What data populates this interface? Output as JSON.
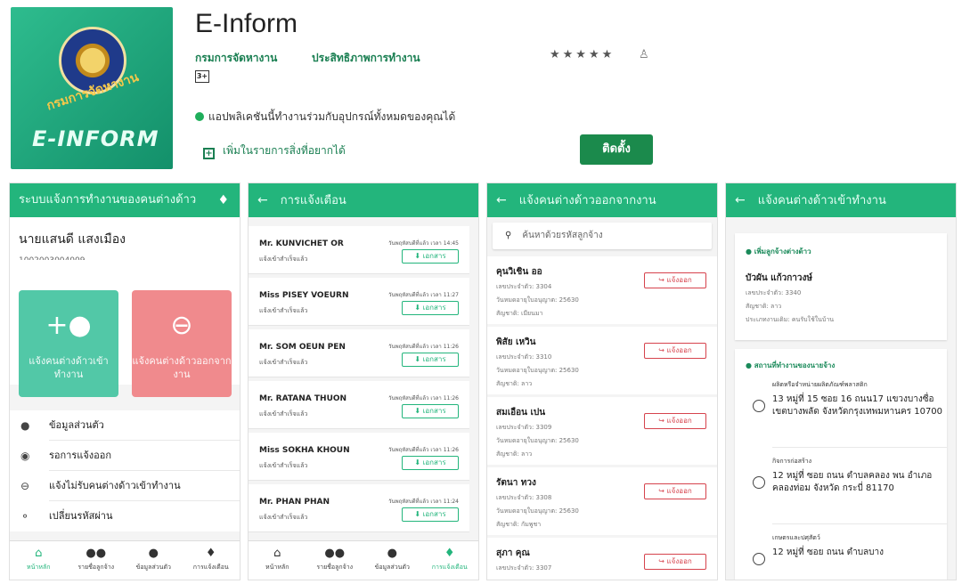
{
  "store": {
    "logo_text": "E-INFORM",
    "logo_arc": "กรมการจัดหางาน",
    "title": "E-Inform",
    "developer": "กรมการจัดหางาน",
    "category": "ประสิทธิภาพการทำงาน",
    "stars": "★★★★★",
    "rating_badge": "3+",
    "compat_text": "แอปพลิเคชันนี้ทำงานร่วมกับอุปกรณ์ทั้งหมดของคุณได้",
    "wishlist_label": "เพิ่มในรายการสิ่งที่อยากได้",
    "install_label": "ติดตั้ง"
  },
  "screen1": {
    "header": "ระบบแจ้งการทำงานของคนต่างด้าว",
    "user_name": "นายแสนดี แสงเมือง",
    "user_id": "1002003004009",
    "tile_in": "แจ้งคนต่างด้าวเข้าทำงาน",
    "tile_out": "แจ้งคนต่างด้าวออกจากงาน",
    "menu": [
      {
        "label": "ข้อมูลส่วนตัว"
      },
      {
        "label": "รอการแจ้งออก"
      },
      {
        "label": "แจ้งไม่รับคนต่างด้าวเข้าทำงาน"
      },
      {
        "label": "เปลี่ยนรหัสผ่าน"
      }
    ]
  },
  "bottom_nav": [
    {
      "label": "หน้าหลัก"
    },
    {
      "label": "รายชื่อลูกจ้าง"
    },
    {
      "label": "ข้อมูลส่วนตัว"
    },
    {
      "label": "การแจ้งเตือน"
    }
  ],
  "screen2": {
    "header": "การแจ้งเตือน",
    "doc_label": "เอกสาร",
    "notifications": [
      {
        "name": "Mr. KUNVICHET OR",
        "status": "แจ้งเข้าสำเร็จแล้ว",
        "time": "วันพฤหัสบดีที่แล้ว เวลา 14:45"
      },
      {
        "name": "Miss PISEY VOEURN",
        "status": "แจ้งเข้าสำเร็จแล้ว",
        "time": "วันพฤหัสบดีที่แล้ว เวลา 11:27"
      },
      {
        "name": "Mr. SOM OEUN PEN",
        "status": "แจ้งเข้าสำเร็จแล้ว",
        "time": "วันพฤหัสบดีที่แล้ว เวลา 11:26"
      },
      {
        "name": "Mr. RATANA THUON",
        "status": "แจ้งเข้าสำเร็จแล้ว",
        "time": "วันพฤหัสบดีที่แล้ว เวลา 11:26"
      },
      {
        "name": "Miss SOKHA KHOUN",
        "status": "แจ้งเข้าสำเร็จแล้ว",
        "time": "วันพฤหัสบดีที่แล้ว เวลา 11:26"
      },
      {
        "name": "Mr. PHAN PHAN",
        "status": "แจ้งเข้าสำเร็จแล้ว",
        "time": "วันพฤหัสบดีที่แล้ว เวลา 11:24"
      }
    ]
  },
  "screen3": {
    "header": "แจ้งคนต่างด้าวออกจากงาน",
    "search_placeholder": "ค้นหาด้วยรหัสลูกจ้าง",
    "out_label": "แจ้งออก",
    "workers": [
      {
        "name": "คุนวิเชิน ออ",
        "id": "เลขประจำตัว: 3304",
        "date": "วันหมดอายุใบอนุญาต: 25630",
        "nationality": "สัญชาติ: เมียนมา"
      },
      {
        "name": "พิสัย เหวิน",
        "id": "เลขประจำตัว: 3310",
        "date": "วันหมดอายุใบอนุญาต: 25630",
        "nationality": "สัญชาติ: ลาว"
      },
      {
        "name": "สมเอือน เปน",
        "id": "เลขประจำตัว: 3309",
        "date": "วันหมดอายุใบอนุญาต: 25630",
        "nationality": "สัญชาติ: ลาว"
      },
      {
        "name": "รัตนา ทวง",
        "id": "เลขประจำตัว: 3308",
        "date": "วันหมดอายุใบอนุญาต: 25630",
        "nationality": "สัญชาติ: กัมพูชา"
      },
      {
        "name": "สุภา คุณ",
        "id": "เลขประจำตัว: 3307",
        "date": "",
        "nationality": ""
      }
    ]
  },
  "screen4": {
    "header": "แจ้งคนต่างด้าวเข้าทำงาน",
    "info_head": "เพิ่มลูกจ้างต่างด้าว",
    "worker_name": "บัวผัน แก้วกาวงษ์",
    "worker_id": "เลขประจำตัว: 3340",
    "worker_nat": "สัญชาติ: ลาว",
    "worker_type": "ประเภทงานเดิม: คนรับใช้ในบ้าน",
    "place_head": "สถานที่ทำงานของนายจ้าง",
    "places": [
      {
        "type": "ผลิตหรือจำหน่ายผลิตภัณฑ์พลาสติก",
        "addr": "13 หมู่ที่ 15 ซอย 16 ถนน17 แขวงบางซื่อ เขตบางพลัด จังหวัดกรุงเทพมหานคร 10700"
      },
      {
        "type": "กิจการก่อสร้าง",
        "addr": "12 หมู่ที่ ซอย ถนน ตำบลคลอง พน อำเภอคลองท่อม จังหวัด กระบี่ 81170"
      },
      {
        "type": "เกษตรและปศุสัตว์",
        "addr": "12 หมู่ที่ ซอย ถนน ตำบลบาง"
      }
    ]
  }
}
